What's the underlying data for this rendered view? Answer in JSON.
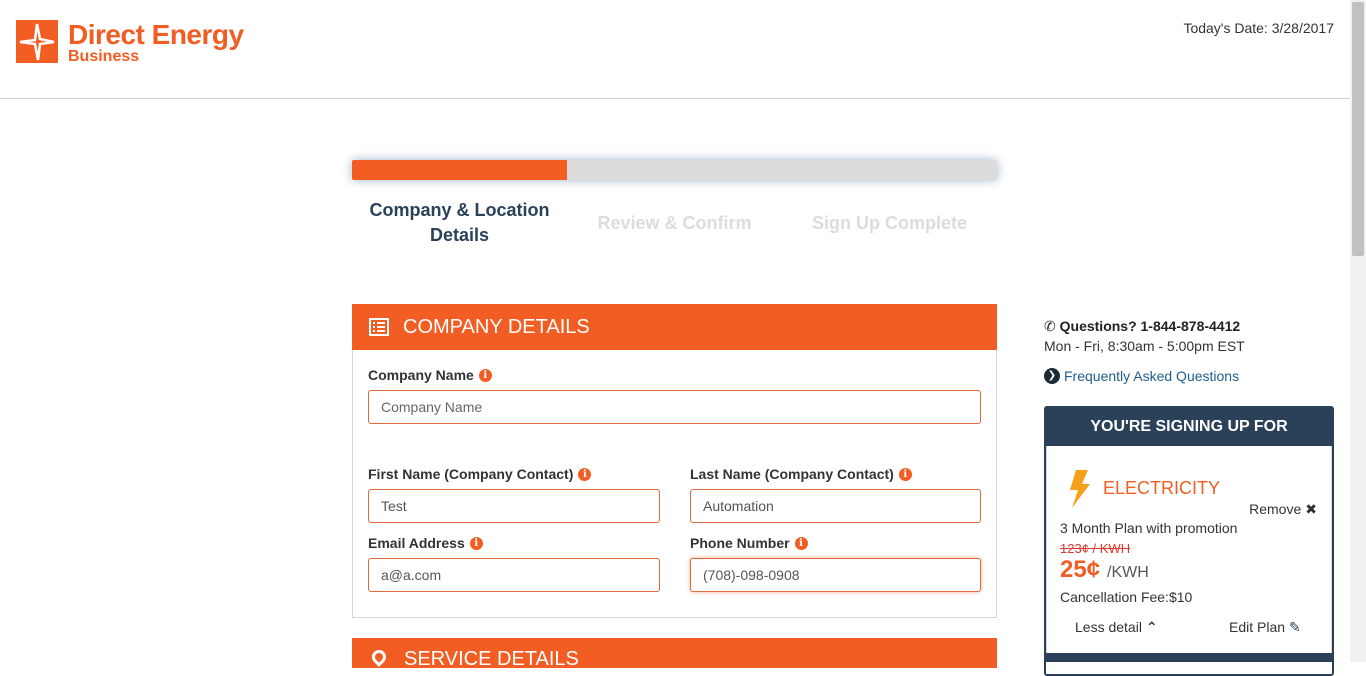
{
  "header": {
    "brand_title": "Direct Energy",
    "brand_sub": "Business",
    "today_date": "Today's Date: 3/28/2017"
  },
  "progress": {
    "fraction": 0.333
  },
  "steps": [
    {
      "label": "Company & Location Details",
      "line1": "Company & Location",
      "line2": "Details",
      "active": true
    },
    {
      "label": "Review & Confirm",
      "active": false
    },
    {
      "label": "Sign Up Complete",
      "active": false
    }
  ],
  "company_details": {
    "title": "COMPANY DETAILS",
    "company_name": {
      "label": "Company Name",
      "placeholder": "Company Name",
      "value": ""
    },
    "first_name": {
      "label": "First Name (Company Contact)",
      "value": "Test"
    },
    "last_name": {
      "label": "Last Name (Company Contact)",
      "value": "Automation"
    },
    "email": {
      "label": "Email Address",
      "value": "a@a.com"
    },
    "phone": {
      "label": "Phone Number",
      "value": "(708)-098-0908"
    }
  },
  "service_details": {
    "title": "SERVICE DETAILS"
  },
  "sidebar": {
    "questions": "Questions? 1-844-878-4412",
    "hours": "Mon - Fri, 8:30am - 5:00pm EST",
    "faq": "Frequently Asked Questions",
    "card": {
      "title": "YOU'RE SIGNING UP FOR",
      "remove": "Remove",
      "product": "ELECTRICITY",
      "plan": "3 Month Plan with promotion",
      "old_price": "123¢ / KWH",
      "new_price": "25¢",
      "unit": "/KWH",
      "fee": "Cancellation Fee:$10",
      "less_detail": "Less detail",
      "edit_plan": "Edit Plan"
    }
  },
  "colors": {
    "brand": "#f15d22",
    "navy": "#2a4159"
  }
}
